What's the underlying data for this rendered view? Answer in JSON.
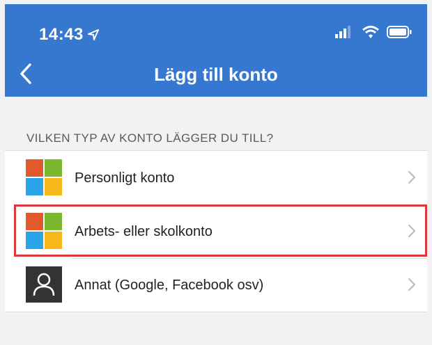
{
  "status_bar": {
    "time": "14:43"
  },
  "header": {
    "title": "Lägg till konto"
  },
  "section": {
    "heading": "VILKEN TYP AV KONTO LÄGGER DU TILL?"
  },
  "accounts": [
    {
      "label": "Personligt konto",
      "icon": "microsoft-logo-icon"
    },
    {
      "label": "Arbets- eller skolkonto",
      "icon": "microsoft-logo-icon",
      "highlighted": true
    },
    {
      "label": "Annat (Google, Facebook osv)",
      "icon": "person-icon"
    }
  ],
  "colors": {
    "header_bg": "#3677d0",
    "highlight": "#d9373b",
    "ms_red": "#e05a2b",
    "ms_green": "#7cb82f",
    "ms_blue": "#2aa3e8",
    "ms_yellow": "#f5b719"
  }
}
